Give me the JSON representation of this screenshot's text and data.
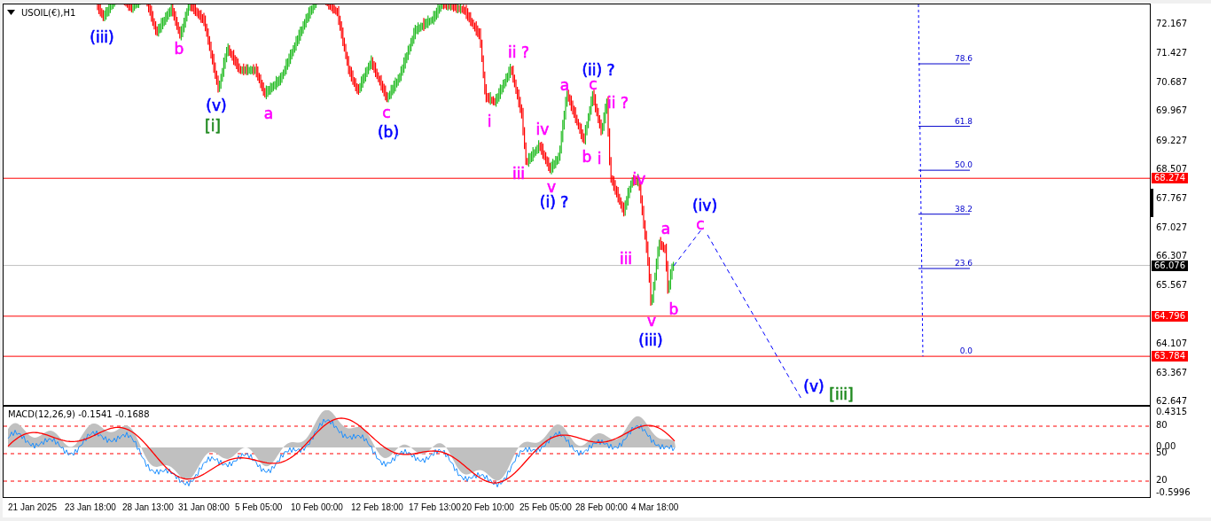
{
  "chart": {
    "symbol": "USOIL(€),H1",
    "price_axis": [
      "72.167",
      "71.427",
      "70.687",
      "69.967",
      "69.227",
      "68.507",
      "67.767",
      "67.027",
      "66.307",
      "65.567",
      "64.107",
      "63.367",
      "62.647"
    ],
    "price_lines": [
      {
        "price": "68.274",
        "color": "#ff0000"
      },
      {
        "price": "66.076",
        "color": "#000000"
      },
      {
        "price": "64.796",
        "color": "#ff0000"
      },
      {
        "price": "63.784",
        "color": "#ff0000"
      }
    ],
    "fib_levels": [
      {
        "label": "78.6"
      },
      {
        "label": "61.8"
      },
      {
        "label": "50.0"
      },
      {
        "label": "38.2"
      },
      {
        "label": "23.6"
      },
      {
        "label": "0.0"
      }
    ],
    "wave_labels": [
      {
        "text": "(iii)",
        "color": "#0000ff"
      },
      {
        "text": "b",
        "color": "#ff00ff"
      },
      {
        "text": "(v)",
        "color": "#0000ff"
      },
      {
        "text": "[i]",
        "color": "#228b22"
      },
      {
        "text": "a",
        "color": "#ff00ff"
      },
      {
        "text": "c",
        "color": "#ff00ff"
      },
      {
        "text": "(b)",
        "color": "#0000ff"
      },
      {
        "text": "i",
        "color": "#ff00ff"
      },
      {
        "text": "ii ?",
        "color": "#ff00ff"
      },
      {
        "text": "(ii) ?",
        "color": "#0000ff"
      },
      {
        "text": "a",
        "color": "#ff00ff"
      },
      {
        "text": "c",
        "color": "#ff00ff"
      },
      {
        "text": "ii ?",
        "color": "#ff00ff"
      },
      {
        "text": "iv",
        "color": "#ff00ff"
      },
      {
        "text": "iii",
        "color": "#ff00ff"
      },
      {
        "text": "v",
        "color": "#ff00ff"
      },
      {
        "text": "(i) ?",
        "color": "#0000ff"
      },
      {
        "text": "b",
        "color": "#ff00ff"
      },
      {
        "text": "i",
        "color": "#ff00ff"
      },
      {
        "text": "iv",
        "color": "#ff00ff"
      },
      {
        "text": "iii",
        "color": "#ff00ff"
      },
      {
        "text": "a",
        "color": "#ff00ff"
      },
      {
        "text": "(iv)",
        "color": "#0000ff"
      },
      {
        "text": "c",
        "color": "#ff00ff"
      },
      {
        "text": "v",
        "color": "#ff00ff"
      },
      {
        "text": "b",
        "color": "#ff00ff"
      },
      {
        "text": "(iii)",
        "color": "#0000ff"
      },
      {
        "text": "(v)",
        "color": "#0000ff"
      },
      {
        "text": "[iii]",
        "color": "#228b22"
      }
    ]
  },
  "macd": {
    "title": "MACD(12,26,9) -0.1541 -0.1688",
    "axis_labels": [
      "0.4315",
      "80",
      "0.00",
      "50",
      "20",
      "-0.5996"
    ]
  },
  "time_axis": [
    "21 Jan 2025",
    "23 Jan 18:00",
    "28 Jan 13:00",
    "31 Jan 08:00",
    "5 Feb 05:00",
    "10 Feb 00:00",
    "12 Feb 18:00",
    "17 Feb 13:00",
    "20 Feb 10:00",
    "25 Feb 05:00",
    "28 Feb 00:00",
    "4 Mar 18:00"
  ]
}
